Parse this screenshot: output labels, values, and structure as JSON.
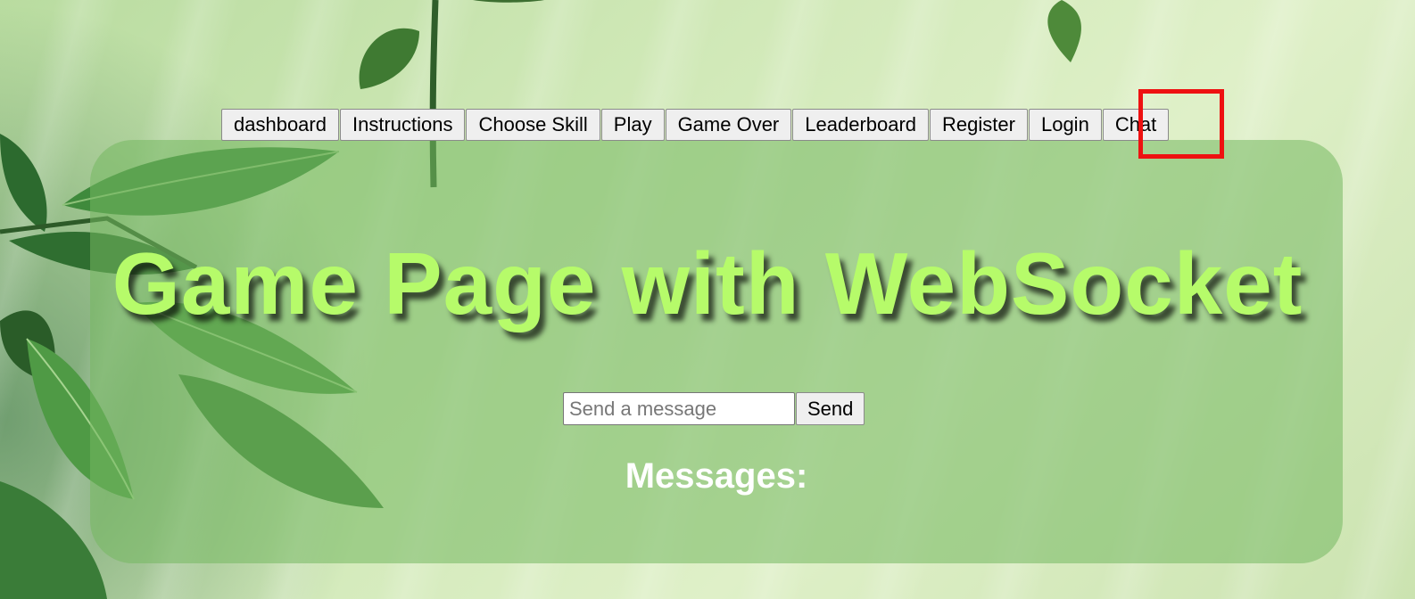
{
  "nav": {
    "items": [
      {
        "label": "dashboard"
      },
      {
        "label": "Instructions"
      },
      {
        "label": "Choose Skill"
      },
      {
        "label": "Play"
      },
      {
        "label": "Game Over"
      },
      {
        "label": "Leaderboard"
      },
      {
        "label": "Register"
      },
      {
        "label": "Login"
      },
      {
        "label": "Chat"
      }
    ]
  },
  "main": {
    "title": "Game Page with WebSocket",
    "message_input": {
      "value": "",
      "placeholder": "Send a message"
    },
    "send_label": "Send",
    "messages_heading": "Messages:"
  },
  "colors": {
    "title": "#b6fb6a",
    "highlight": "#ee1111",
    "panel": "#74b860"
  }
}
